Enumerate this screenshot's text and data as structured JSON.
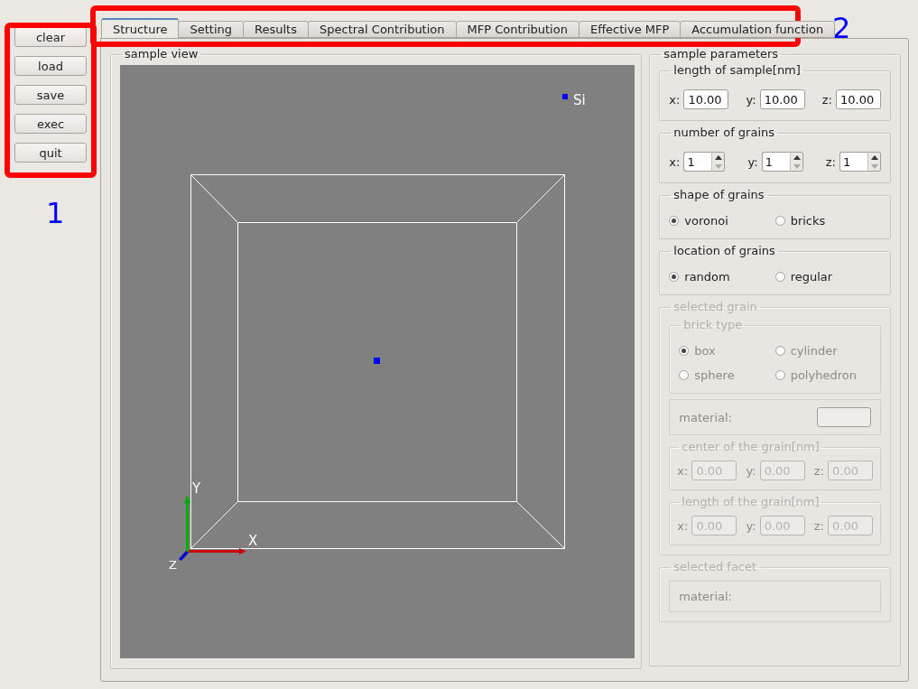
{
  "action_buttons": [
    {
      "label": "clear"
    },
    {
      "label": "load"
    },
    {
      "label": "save"
    },
    {
      "label": "exec"
    },
    {
      "label": "quit"
    }
  ],
  "tabs": [
    {
      "label": "Structure",
      "selected": true
    },
    {
      "label": "Setting",
      "selected": false
    },
    {
      "label": "Results",
      "selected": false
    },
    {
      "label": "Spectral Contribution",
      "selected": false
    },
    {
      "label": "MFP Contribution",
      "selected": false
    },
    {
      "label": "Effective MFP",
      "selected": false
    },
    {
      "label": "Accumulation function",
      "selected": false
    }
  ],
  "sample_view": {
    "title": "sample view",
    "legend": {
      "label": "Si",
      "color": "#0000ff"
    },
    "axes": [
      {
        "label": "X",
        "color": "#cc0000"
      },
      {
        "label": "Y",
        "color": "#00b000"
      },
      {
        "label": "Z",
        "color": "#0000dd"
      }
    ]
  },
  "sample_parameters": {
    "title": "sample parameters",
    "length_of_sample": {
      "title": "length of sample[nm]",
      "disabled": false,
      "fields": [
        {
          "label": "x:",
          "value": "10.00"
        },
        {
          "label": "y:",
          "value": "10.00"
        },
        {
          "label": "z:",
          "value": "10.00"
        }
      ]
    },
    "number_of_grains": {
      "title": "number of grains",
      "disabled": false,
      "fields": [
        {
          "label": "x:",
          "value": "1"
        },
        {
          "label": "y:",
          "value": "1"
        },
        {
          "label": "z:",
          "value": "1"
        }
      ]
    },
    "shape_of_grains": {
      "title": "shape of grains",
      "disabled": false,
      "options": [
        {
          "label": "voronoi",
          "selected": true
        },
        {
          "label": "bricks",
          "selected": false
        }
      ]
    },
    "location_of_grains": {
      "title": "location of grains",
      "disabled": false,
      "options": [
        {
          "label": "random",
          "selected": true
        },
        {
          "label": "regular",
          "selected": false
        }
      ]
    },
    "selected_grain": {
      "title": "selected grain",
      "disabled": true,
      "brick_type": {
        "title": "brick type",
        "options": [
          {
            "label": "box",
            "selected": true
          },
          {
            "label": "cylinder",
            "selected": false
          },
          {
            "label": "sphere",
            "selected": false
          },
          {
            "label": "polyhedron",
            "selected": false
          }
        ]
      },
      "material": {
        "label": "material:"
      },
      "center_of_grain": {
        "title": "center of the grain[nm]",
        "fields": [
          {
            "label": "x:",
            "value": "0.00"
          },
          {
            "label": "y:",
            "value": "0.00"
          },
          {
            "label": "z:",
            "value": "0.00"
          }
        ]
      },
      "length_of_grain": {
        "title": "length of the grain[nm]",
        "fields": [
          {
            "label": "x:",
            "value": "0.00"
          },
          {
            "label": "y:",
            "value": "0.00"
          },
          {
            "label": "z:",
            "value": "0.00"
          }
        ]
      }
    },
    "selected_facet": {
      "title": "selected facet",
      "disabled": true,
      "material": {
        "label": "material:"
      }
    }
  },
  "annotations": [
    {
      "label": "1"
    },
    {
      "label": "2"
    }
  ]
}
